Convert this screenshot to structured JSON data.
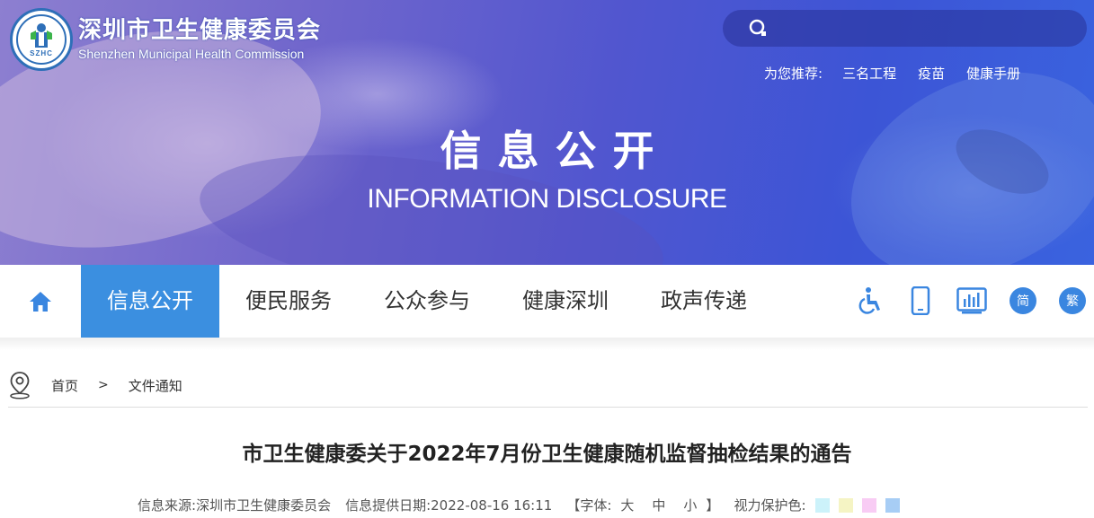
{
  "header": {
    "logo_cn": "深圳市卫生健康委员会",
    "logo_en": "Shenzhen Municipal Health Commission",
    "logo_emblem_text": "SZHC",
    "search": {
      "placeholder": ""
    },
    "recommend": {
      "label": "为您推荐:",
      "links": [
        "三名工程",
        "疫苗",
        "健康手册"
      ]
    },
    "banner_title": "信息公开",
    "banner_subtitle": "INFORMATION DISCLOSURE"
  },
  "nav": {
    "items": [
      {
        "label": "信息公开",
        "active": true
      },
      {
        "label": "便民服务",
        "active": false
      },
      {
        "label": "公众参与",
        "active": false
      },
      {
        "label": "健康深圳",
        "active": false
      },
      {
        "label": "政声传递",
        "active": false
      }
    ],
    "tools": {
      "accessibility": "accessibility-icon",
      "mobile": "mobile-icon",
      "stats": "chart-icon",
      "simplified": "简",
      "traditional": "繁"
    }
  },
  "breadcrumb": {
    "items": [
      "首页",
      "文件通知"
    ],
    "separator": ">"
  },
  "article": {
    "title": "市卫生健康委关于2022年7月份卫生健康随机监督抽检结果的通告",
    "source_label": "信息来源:",
    "source": "深圳市卫生健康委员会",
    "date_label": "信息提供日期:",
    "date": "2022-08-16 16:11",
    "font_open": "【字体:",
    "font_large": "大",
    "font_medium": "中",
    "font_small": "小",
    "font_close": "】",
    "eye_label": "视力保护色:",
    "eye_colors": [
      "#ccf2fa",
      "#f5f4c4",
      "#f8ccf4",
      "#a7cdf5"
    ]
  },
  "colors": {
    "accent": "#3b8fe0",
    "tool_blue": "#3a86e0"
  }
}
